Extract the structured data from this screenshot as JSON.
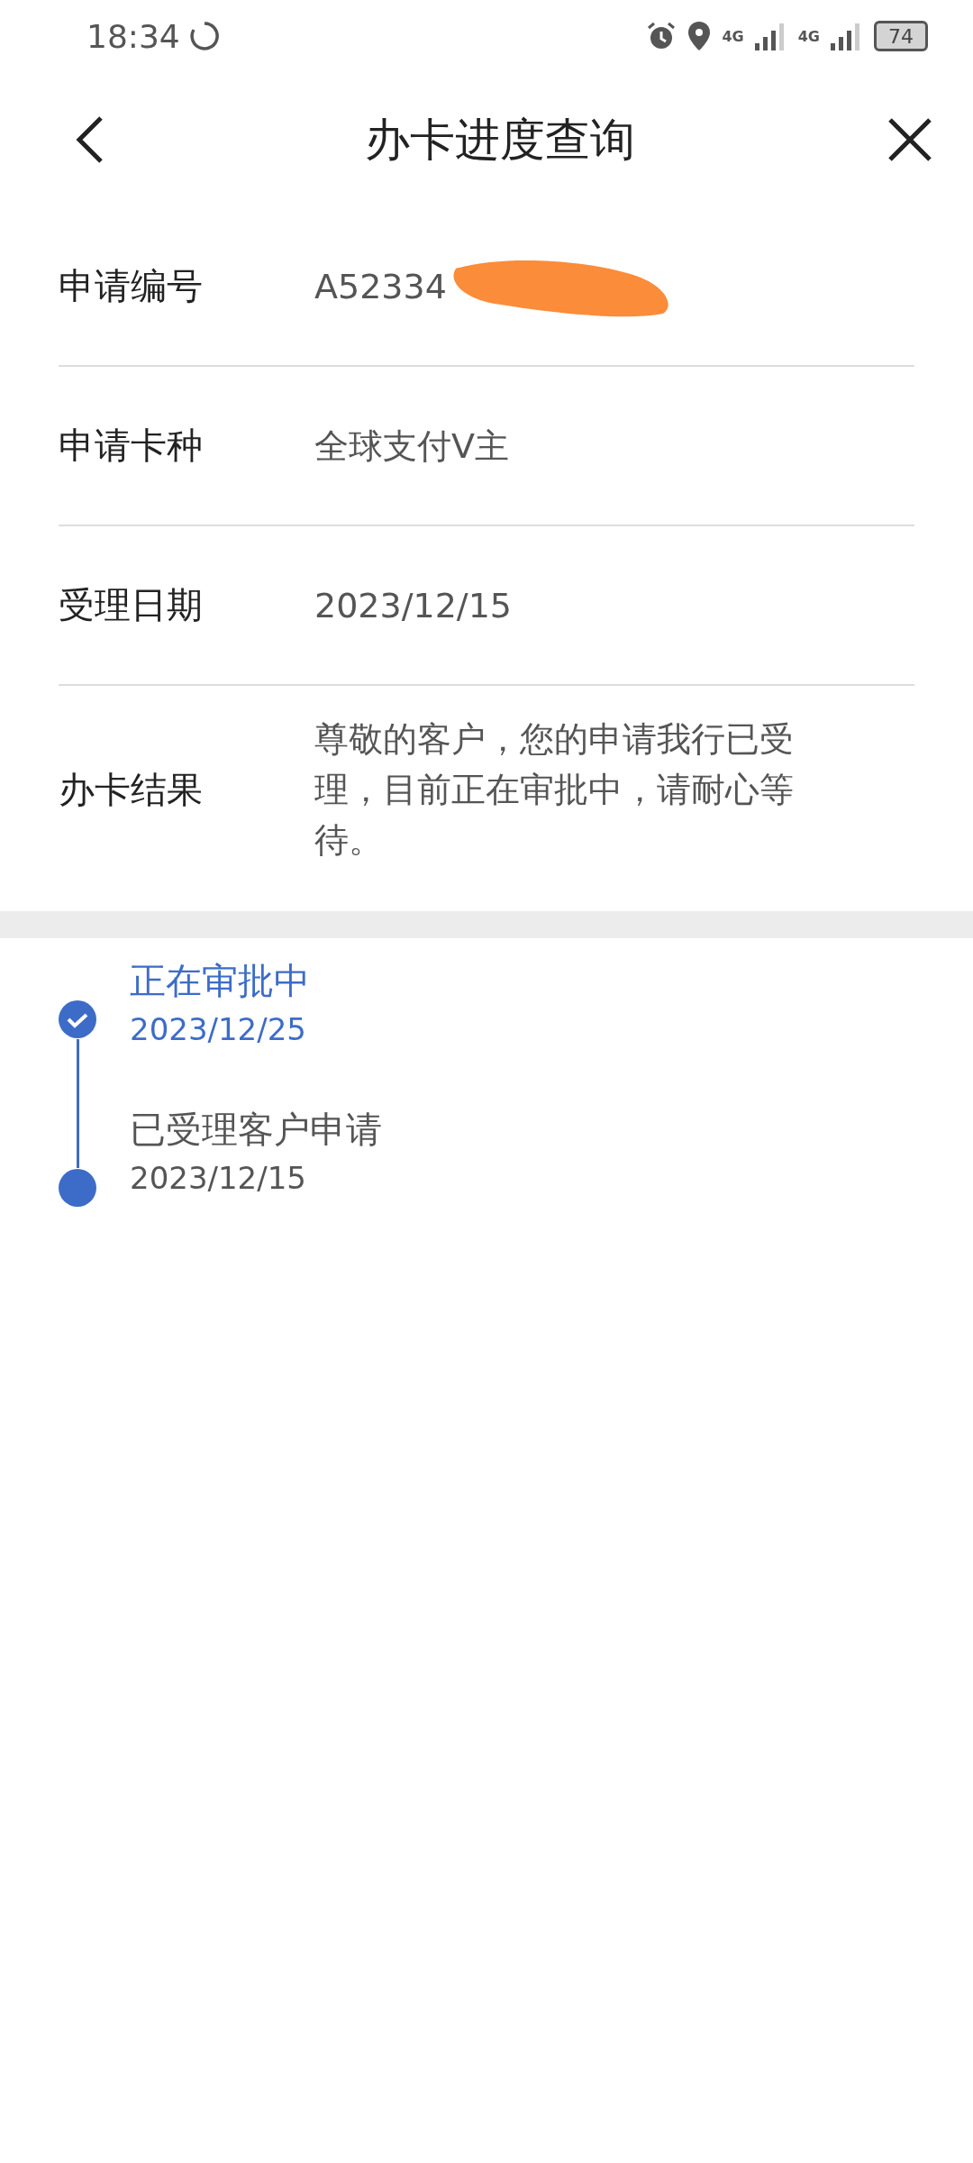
{
  "status_bar": {
    "time": "18:34",
    "battery": "74",
    "network_1": "4G",
    "network_2": "4G"
  },
  "header": {
    "title": "办卡进度查询"
  },
  "fields": [
    {
      "label": "申请编号",
      "value": "A52334",
      "redacted": true
    },
    {
      "label": "申请卡种",
      "value": "全球支付V主",
      "redacted": false
    },
    {
      "label": "受理日期",
      "value": "2023/12/15",
      "redacted": false
    },
    {
      "label": "办卡结果",
      "value": "尊敬的客户，您的申请我行已受理，目前正在审批中，请耐心等待。",
      "redacted": false
    }
  ],
  "timeline": [
    {
      "title": "正在审批中",
      "date": "2023/12/25",
      "current": true
    },
    {
      "title": "已受理客户申请",
      "date": "2023/12/15",
      "current": false
    }
  ]
}
